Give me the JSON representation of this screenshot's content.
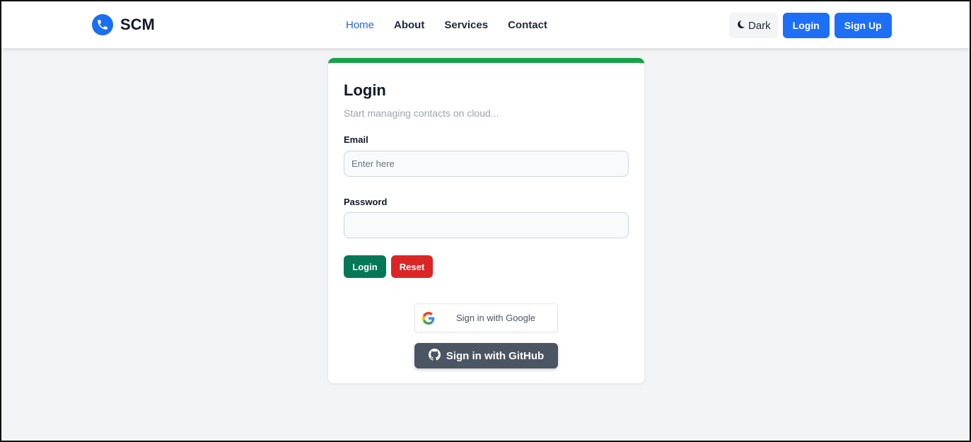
{
  "navbar": {
    "brand": {
      "name": "SCM",
      "icon": "phone-icon",
      "icon_color": "#1a6ff0"
    },
    "links": [
      {
        "label": "Home",
        "active": true
      },
      {
        "label": "About"
      },
      {
        "label": "Services"
      },
      {
        "label": "Contact"
      }
    ],
    "actions": {
      "dark_label": "Dark",
      "dark_icon": "moon-icon",
      "login_label": "Login",
      "signup_label": "Sign Up"
    }
  },
  "login_card": {
    "title": "Login",
    "subtitle": "Start managing contacts on cloud...",
    "email": {
      "label": "Email",
      "placeholder": "Enter here",
      "value": ""
    },
    "password": {
      "label": "Password",
      "placeholder": "",
      "value": ""
    },
    "login_button": "Login",
    "reset_button": "Reset",
    "google_button": "Sign in with Google",
    "github_button": "Sign in with GitHub"
  },
  "colors": {
    "primary": "#1d6ff5",
    "accent_bar": "#16a34a",
    "login_green": "#047857",
    "reset_red": "#dc2626",
    "github_gray": "#4b5563"
  }
}
